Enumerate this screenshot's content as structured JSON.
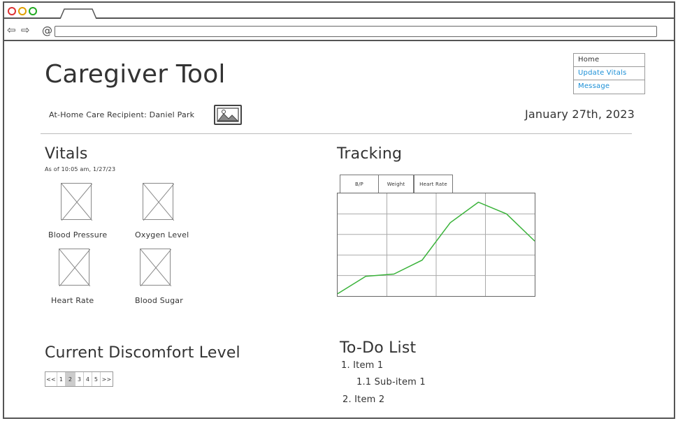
{
  "app": {
    "title": "Caregiver Tool",
    "recipient": "At-Home Care Recipient: Daniel Park",
    "date": "January 27th, 2023"
  },
  "nav": {
    "items": [
      {
        "label": "Home",
        "style": "plain"
      },
      {
        "label": "Update Vitals",
        "style": "link"
      },
      {
        "label": "Message",
        "style": "link"
      }
    ],
    "link_color": "#1b8fd6"
  },
  "vitals": {
    "title": "Vitals",
    "subtitle": "As of 10:05 am, 1/27/23",
    "items": [
      {
        "label": "Blood Pressure"
      },
      {
        "label": "Oxygen Level"
      },
      {
        "label": "Heart Rate"
      },
      {
        "label": "Blood Sugar"
      }
    ]
  },
  "tracking": {
    "title": "Tracking",
    "tabs": [
      "B/P",
      "Weight",
      "Heart Rate"
    ],
    "line_color": "#3bb33b"
  },
  "chart_data": {
    "type": "line",
    "title": "",
    "xlabel": "",
    "ylabel": "",
    "grid": true,
    "x": [
      0,
      1,
      2,
      3,
      4,
      5,
      6,
      7
    ],
    "series": [
      {
        "values": [
          3,
          27,
          30,
          49,
          100,
          128,
          112,
          75
        ]
      }
    ],
    "ylim": [
      0,
      140
    ]
  },
  "discomfort": {
    "title": "Current Discomfort Level",
    "pager": {
      "prev": "<<",
      "pages": [
        "1",
        "2",
        "3",
        "4",
        "5"
      ],
      "next": ">>",
      "selected": "2"
    }
  },
  "todo": {
    "title": "To-Do List",
    "items": [
      {
        "text": "1. Item 1",
        "level": 0
      },
      {
        "text": "1.1 Sub-item 1",
        "level": 1
      },
      {
        "text": "2. Item 2",
        "level": 0
      }
    ]
  },
  "browser": {
    "icons": [
      "back-arrow-icon",
      "forward-arrow-icon",
      "reload-icon"
    ]
  }
}
